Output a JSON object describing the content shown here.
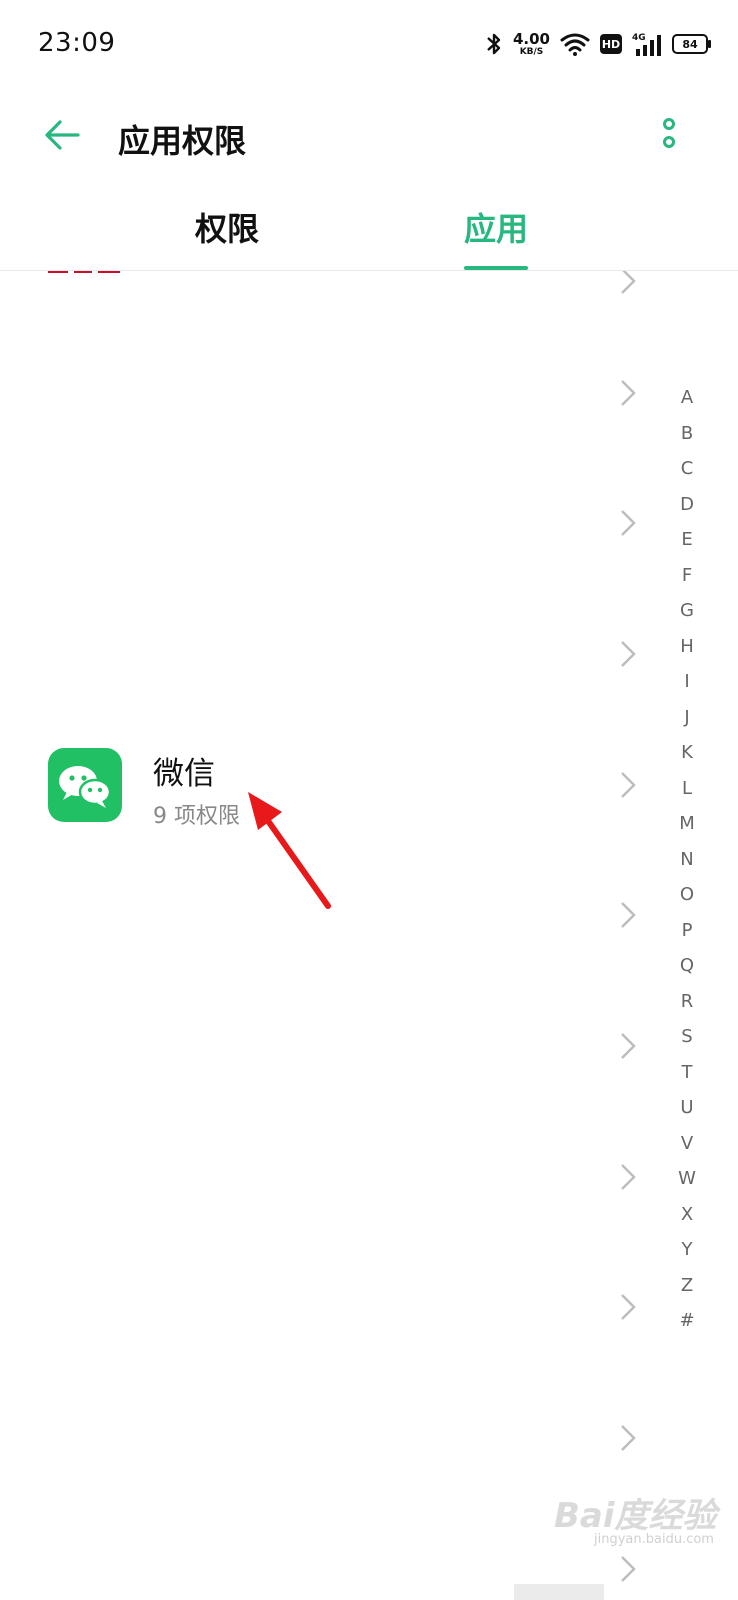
{
  "status_bar": {
    "time": "23:09",
    "net_speed": "4.00",
    "net_unit": "KB/S",
    "hd_label": "HD",
    "signal_label": "4G",
    "battery": "84"
  },
  "header": {
    "title": "应用权限",
    "back_icon": "arrow-left-icon",
    "more_icon": "vertical-dots-icon"
  },
  "tabs": [
    {
      "label": "权限",
      "active": false
    },
    {
      "label": "应用",
      "active": true
    }
  ],
  "app_item": {
    "name": "微信",
    "subtitle": "9 项权限",
    "icon": "wechat-icon"
  },
  "alphabet_index": [
    "A",
    "B",
    "C",
    "D",
    "E",
    "F",
    "G",
    "H",
    "I",
    "J",
    "K",
    "L",
    "M",
    "N",
    "O",
    "P",
    "Q",
    "R",
    "S",
    "T",
    "U",
    "V",
    "W",
    "X",
    "Y",
    "Z",
    "#"
  ],
  "watermark": {
    "text": "Bai度经验",
    "sub": "jingyan.baidu.com"
  },
  "colors": {
    "accent": "#28b77f",
    "wechat": "#21c064",
    "annotation": "#e8191b"
  }
}
